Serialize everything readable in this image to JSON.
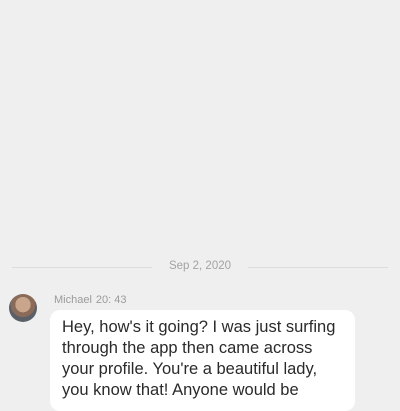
{
  "chat": {
    "date_separator": "Sep 2, 2020",
    "messages": [
      {
        "sender": "Michael",
        "time": "20: 43",
        "text": "Hey, how's it going? I was just surfing through the app then came across your profile. You're a beautiful lady, you know that! Anyone would be"
      }
    ]
  },
  "colors": {
    "background": "#efefef",
    "bubble": "#ffffff",
    "meta_text": "#9b9b9b"
  }
}
